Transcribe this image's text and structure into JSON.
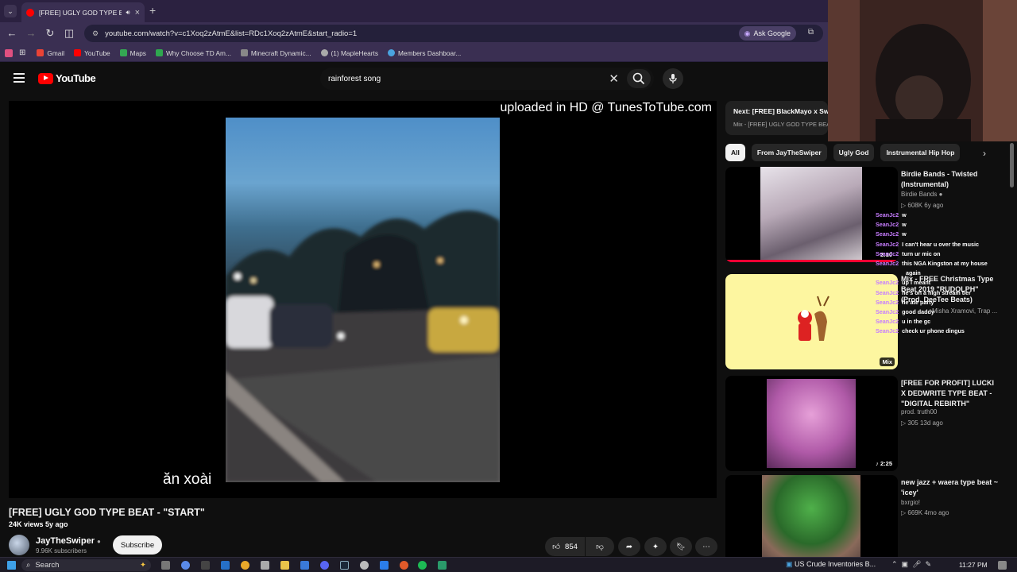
{
  "browser": {
    "tab_title": "[FREE] UGLY GOD TYPE BEAT",
    "url": "youtube.com/watch?v=c1Xoq2zAtmE&list=RDc1Xoq2zAtmE&start_radio=1",
    "ask_google": "Ask Google",
    "bookmarks": [
      {
        "label": "Gmail",
        "color": "#ea4335"
      },
      {
        "label": "YouTube",
        "color": "#ff0000"
      },
      {
        "label": "Maps",
        "color": "#34a853"
      },
      {
        "label": "Why Choose TD Am...",
        "color": "#34a853"
      },
      {
        "label": "Minecraft Dynamic...",
        "color": "#888888"
      },
      {
        "label": "(1) MapleHearts",
        "color": "#aaaaaa"
      },
      {
        "label": "Members Dashboar...",
        "color": "#4aa3df"
      }
    ]
  },
  "youtube": {
    "logo_text": "YouTube",
    "search_value": "rainforest song"
  },
  "player": {
    "watermark": "uploaded in HD @ TunesToTube.com",
    "subtitle": "ăn xoài"
  },
  "video": {
    "title": "[FREE] UGLY GOD TYPE BEAT - \"START\"",
    "meta": "24K views  5y ago",
    "channel": "JayTheSwiper",
    "subscribers": "9.96K subscribers",
    "subscribe_label": "Subscribe",
    "likes": "854"
  },
  "up_next": {
    "title": "Next: [FREE] BlackMayo x Sw",
    "subtitle": "Mix - [FREE] UGLY GOD TYPE BEA"
  },
  "chips": [
    "All",
    "From JayTheSwiper",
    "Ugly God",
    "Instrumental Hip Hop"
  ],
  "recommendations": [
    {
      "title": "Birdie Bands - Twisted (Instrumental)",
      "channel": "Birdie Bands",
      "stats": "▷ 608K  6y ago",
      "duration": "2:10"
    },
    {
      "title": "Mix - FREE Christmas Type Beat 2019 \"RUDOLPH\" (Prod. DeeTee Beats)",
      "channel": "Misha Xramovi, Trap ...",
      "stats": "",
      "duration": "Mix"
    },
    {
      "title": "[FREE FOR PROFIT] LUCKI X DEDWRITE TYPE BEAT - \"DIGITAL REBIRTH\"",
      "channel": "prod. truth00",
      "stats": "▷ 305  13d ago",
      "duration": "2:25"
    },
    {
      "title": "new jazz + waera type beat ~ 'icey'",
      "channel": "bxrgio!",
      "stats": "▷ 669K  4mo ago",
      "duration": ""
    }
  ],
  "chat": [
    {
      "user": "SeanJc2",
      "msg": "w"
    },
    {
      "user": "SeanJc2",
      "msg": "w"
    },
    {
      "user": "SeanJc2",
      "msg": "w"
    },
    {
      "user": "SeanJc2",
      "msg": "I can't hear u over the music"
    },
    {
      "user": "SeanJc2",
      "msg": "turn ur mic on"
    },
    {
      "user": "SeanJc2",
      "msg": "this NGA Kingston at my house"
    },
    {
      "user": "",
      "msg": "again"
    },
    {
      "user": "SeanJc2",
      "msg": "up I meant"
    },
    {
      "user": "SeanJc2",
      "msg": "he's on a high stream tier"
    },
    {
      "user": "SeanJc2",
      "msg": "he ate party"
    },
    {
      "user": "SeanJc2",
      "msg": "good daddy"
    },
    {
      "user": "SeanJc2",
      "msg": "u in the gc"
    },
    {
      "user": "SeanJc2",
      "msg": "check ur phone dingus"
    }
  ],
  "taskbar": {
    "search": "Search",
    "news": "US Crude Inventories B...",
    "time": "11:27 PM"
  }
}
